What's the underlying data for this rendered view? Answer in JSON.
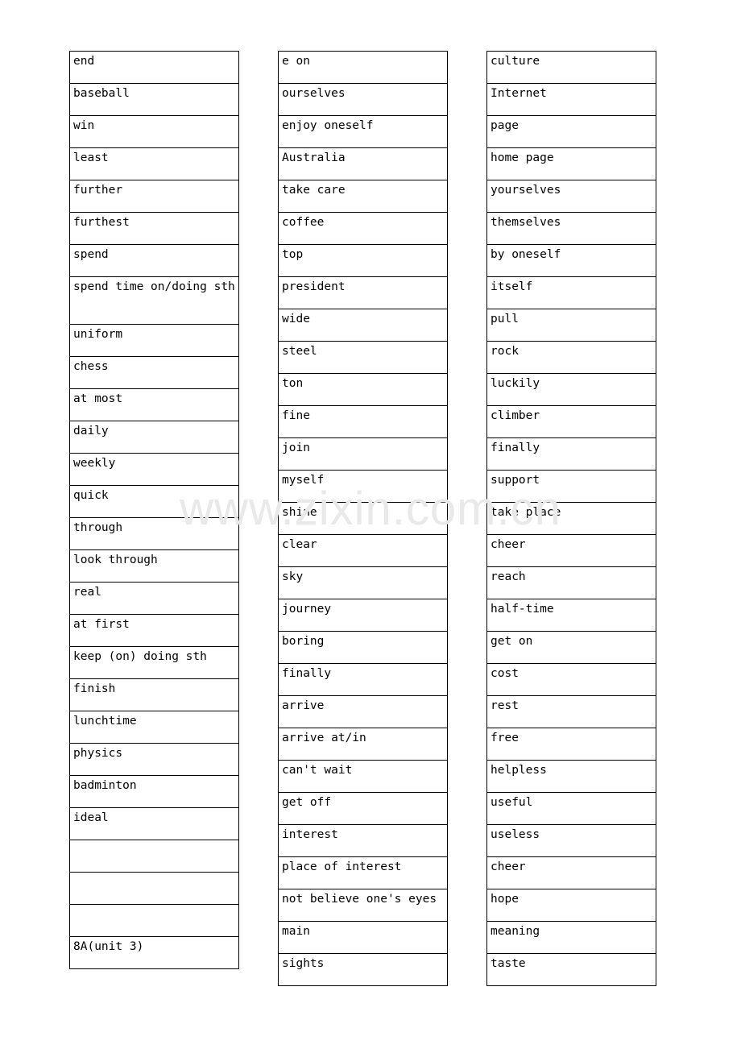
{
  "document": {
    "type": "vocabulary-table",
    "watermark": "www.zixin.com.cn",
    "background_color": "#ffffff",
    "text_color": "#000000",
    "border_color": "#000000",
    "watermark_color": "#e9e9e9"
  },
  "columns": [
    {
      "id": "column-1",
      "rows": [
        {
          "text": "end"
        },
        {
          "text": "baseball"
        },
        {
          "text": "win"
        },
        {
          "text": "least"
        },
        {
          "text": "further"
        },
        {
          "text": "furthest"
        },
        {
          "text": "spend"
        },
        {
          "text": "spend time on/doing sth",
          "tall": true
        },
        {
          "text": "uniform"
        },
        {
          "text": "chess"
        },
        {
          "text": "at most"
        },
        {
          "text": "daily"
        },
        {
          "text": "weekly"
        },
        {
          "text": "quick"
        },
        {
          "text": "through"
        },
        {
          "text": "look through"
        },
        {
          "text": "real"
        },
        {
          "text": "at first"
        },
        {
          "text": "keep (on) doing sth"
        },
        {
          "text": "finish"
        },
        {
          "text": "lunchtime"
        },
        {
          "text": "physics"
        },
        {
          "text": "badminton"
        },
        {
          "text": "ideal"
        },
        {
          "text": ""
        },
        {
          "text": ""
        },
        {
          "text": ""
        },
        {
          "text": "8A(unit 3)"
        }
      ]
    },
    {
      "id": "column-2",
      "rows": [
        {
          "text": "e on"
        },
        {
          "text": "ourselves"
        },
        {
          "text": "enjoy oneself"
        },
        {
          "text": "Australia"
        },
        {
          "text": "take care"
        },
        {
          "text": "coffee"
        },
        {
          "text": "top"
        },
        {
          "text": "president"
        },
        {
          "text": "wide"
        },
        {
          "text": "steel"
        },
        {
          "text": "ton"
        },
        {
          "text": "fine"
        },
        {
          "text": "join"
        },
        {
          "text": "myself"
        },
        {
          "text": "shine"
        },
        {
          "text": "clear"
        },
        {
          "text": "sky"
        },
        {
          "text": "journey"
        },
        {
          "text": "boring"
        },
        {
          "text": "finally"
        },
        {
          "text": "arrive"
        },
        {
          "text": "arrive at/in"
        },
        {
          "text": "can't wait"
        },
        {
          "text": "get off"
        },
        {
          "text": "interest"
        },
        {
          "text": "place of interest"
        },
        {
          "text": "not believe one's eyes"
        },
        {
          "text": "main"
        },
        {
          "text": "sights"
        }
      ]
    },
    {
      "id": "column-3",
      "rows": [
        {
          "text": "culture"
        },
        {
          "text": "Internet"
        },
        {
          "text": "page"
        },
        {
          "text": "home page"
        },
        {
          "text": "yourselves"
        },
        {
          "text": "themselves"
        },
        {
          "text": "by oneself"
        },
        {
          "text": "itself"
        },
        {
          "text": "pull"
        },
        {
          "text": "rock"
        },
        {
          "text": "luckily"
        },
        {
          "text": "climber"
        },
        {
          "text": "finally"
        },
        {
          "text": "support"
        },
        {
          "text": "take place"
        },
        {
          "text": "cheer"
        },
        {
          "text": "reach"
        },
        {
          "text": "half-time"
        },
        {
          "text": "get on"
        },
        {
          "text": "cost"
        },
        {
          "text": "rest"
        },
        {
          "text": "free"
        },
        {
          "text": "helpless"
        },
        {
          "text": "useful"
        },
        {
          "text": "useless"
        },
        {
          "text": "cheer"
        },
        {
          "text": "hope"
        },
        {
          "text": "meaning"
        },
        {
          "text": "taste"
        }
      ]
    }
  ]
}
